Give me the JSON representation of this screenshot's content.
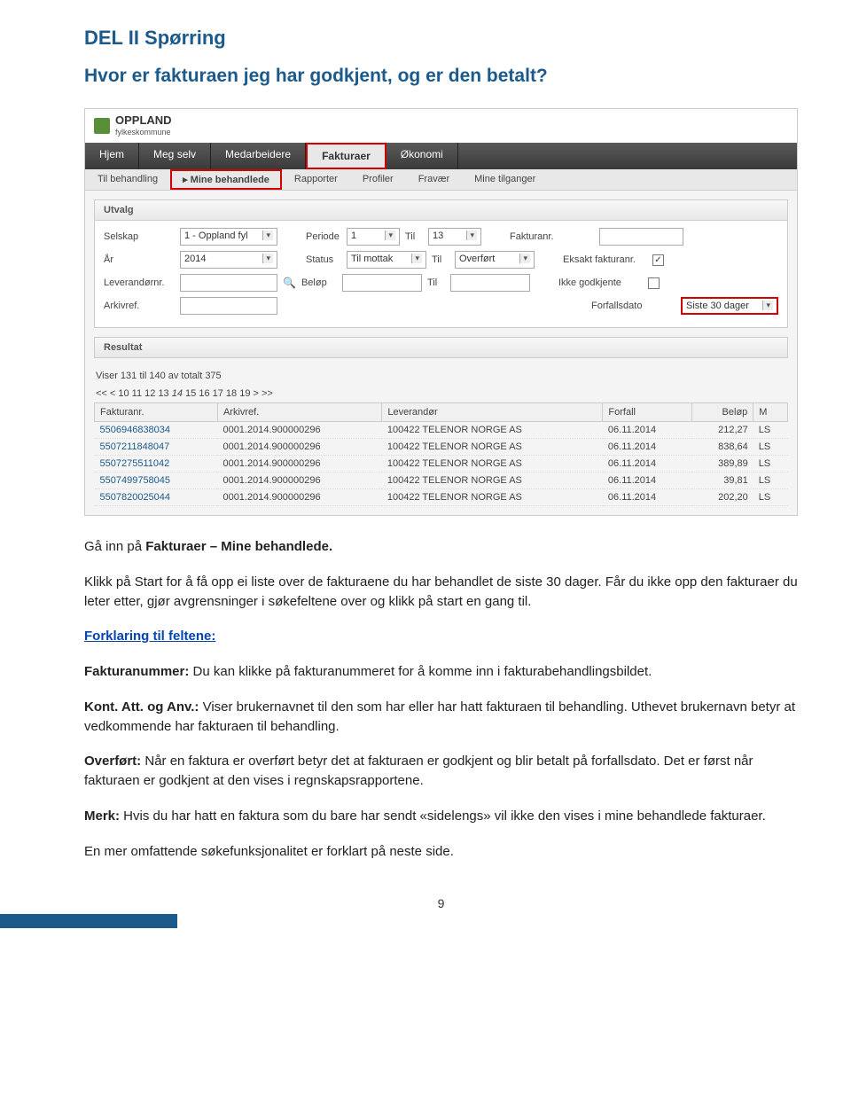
{
  "headings": {
    "section": "DEL II Spørring",
    "question": "Hvor er fakturaen jeg har godkjent, og er den betalt?"
  },
  "app": {
    "logo": "OPPLAND",
    "logo_sub": "fylkeskommune",
    "nav": [
      "Hjem",
      "Meg selv",
      "Medarbeidere",
      "Fakturaer",
      "Økonomi"
    ],
    "active_nav": "Fakturaer",
    "subnav": [
      "Til behandling",
      "▸ Mine behandlede",
      "Rapporter",
      "Profiler",
      "Fravær",
      "Mine tilganger"
    ],
    "highlighted_subnav": "▸ Mine behandlede",
    "utvalg": "Utvalg",
    "resultat": "Resultat",
    "filters": {
      "selskap_lbl": "Selskap",
      "selskap": "1 - Oppland fyl",
      "periode_lbl": "Periode",
      "periode": "1",
      "til_lbl": "Til",
      "til_periode": "13",
      "fakturanr_lbl": "Fakturanr.",
      "ar_lbl": "År",
      "ar": "2014",
      "status_lbl": "Status",
      "status": "Til mottak",
      "til_status": "Overført",
      "eksakt_lbl": "Eksakt fakturanr.",
      "lev_lbl": "Leverandørnr.",
      "belop_lbl": "Beløp",
      "ikke_lbl": "Ikke godkjente",
      "arkivref_lbl": "Arkivref.",
      "forfall_lbl": "Forfallsdato",
      "forfall": "Siste 30 dager"
    },
    "pager_line1": "Viser 131 til 140 av totalt 375",
    "pager_line2": {
      "prefix": "<< < 10 11 12 13 ",
      "current": "14",
      "suffix": " 15 16 17 18 19 > >>"
    },
    "cols": [
      "Fakturanr.",
      "Arkivref.",
      "Leverandør",
      "Forfall",
      "Beløp",
      "M"
    ],
    "rows": [
      {
        "f": "5506946838034",
        "a": "0001.2014.900000296",
        "l": "100422 TELENOR NORGE AS",
        "d": "06.11.2014",
        "b": "212,27",
        "m": "LS"
      },
      {
        "f": "5507211848047",
        "a": "0001.2014.900000296",
        "l": "100422 TELENOR NORGE AS",
        "d": "06.11.2014",
        "b": "838,64",
        "m": "LS"
      },
      {
        "f": "5507275511042",
        "a": "0001.2014.900000296",
        "l": "100422 TELENOR NORGE AS",
        "d": "06.11.2014",
        "b": "389,89",
        "m": "LS"
      },
      {
        "f": "5507499758045",
        "a": "0001.2014.900000296",
        "l": "100422 TELENOR NORGE AS",
        "d": "06.11.2014",
        "b": "39,81",
        "m": "LS"
      },
      {
        "f": "5507820025044",
        "a": "0001.2014.900000296",
        "l": "100422 TELENOR NORGE AS",
        "d": "06.11.2014",
        "b": "202,20",
        "m": "LS"
      }
    ]
  },
  "body": {
    "p1_a": "Gå inn på ",
    "p1_b": "Fakturaer – Mine behandlede.",
    "p2": "Klikk på Start for å få opp ei liste over de fakturaene du har behandlet de siste 30 dager. Får du ikke opp den fakturaer du leter etter, gjør avgrensninger i søkefeltene over og klikk på start en gang til.",
    "forklaring": "Forklaring til feltene:",
    "f_num_b": "Fakturanummer:",
    "f_num": " Du kan klikke på fakturanummeret for å komme inn i fakturabehandlingsbildet.",
    "kont_b": "Kont. Att. og Anv.:",
    "kont": " Viser brukernavnet til den som har eller har hatt fakturaen til behandling. Uthevet brukernavn betyr at vedkommende har fakturaen til behandling.",
    "over_b": "Overført:",
    "over": " Når en faktura er overført betyr det at fakturaen er godkjent og blir betalt på forfallsdato. Det er først når fakturaen er godkjent at den vises i regnskapsrapportene.",
    "merk_b": "Merk:",
    "merk": " Hvis du har hatt en faktura som du bare har sendt «sidelengs» vil ikke den vises i mine behandlede fakturaer.",
    "more": "En mer omfattende søkefunksjonalitet er forklart på neste side."
  },
  "page": "9"
}
